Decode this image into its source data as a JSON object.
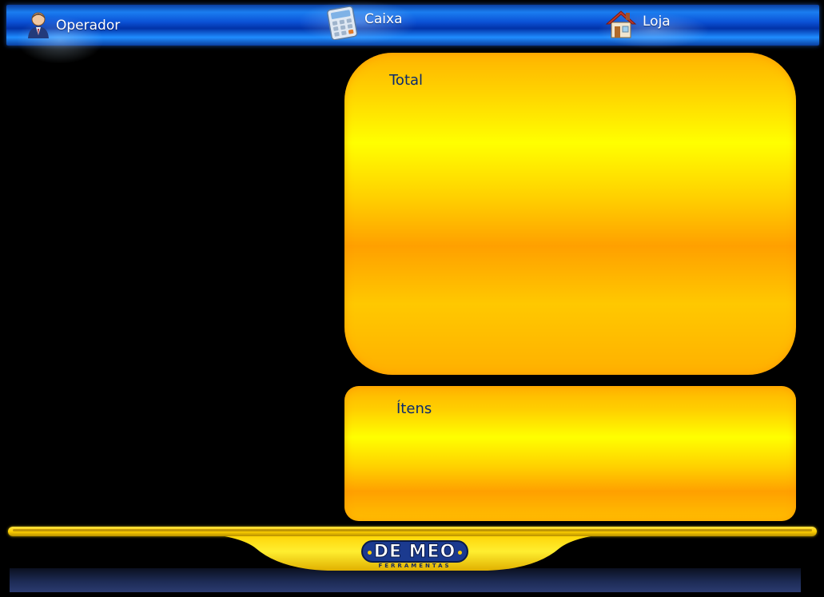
{
  "nav": {
    "operador": {
      "label": "Operador",
      "icon": "user-icon"
    },
    "caixa": {
      "label": "Caixa",
      "icon": "calculator-icon"
    },
    "loja": {
      "label": "Loja",
      "icon": "house-icon"
    }
  },
  "panels": {
    "total": {
      "title": "Total"
    },
    "itens": {
      "title": "Ítens"
    }
  },
  "footer": {
    "logo": {
      "text": "DE MEO",
      "subtext": "FERRAMENTAS"
    }
  },
  "colors": {
    "topbar": "#0b52d6",
    "panel_yellow": "#ffff00",
    "panel_orange": "#ffa000",
    "title_text": "#0a2a6e",
    "logo_blue": "#1b3a8f"
  }
}
